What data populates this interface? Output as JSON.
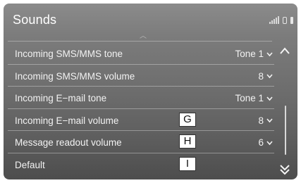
{
  "header": {
    "title": "Sounds"
  },
  "status_icons": [
    "signal-strength-icon",
    "phone-icon",
    "battery-icon"
  ],
  "settings": [
    {
      "label": "Incoming SMS/MMS tone",
      "value": "Tone 1",
      "callout": ""
    },
    {
      "label": "Incoming SMS/MMS volume",
      "value": "8",
      "callout": ""
    },
    {
      "label": "Incoming E−mail tone",
      "value": "Tone 1",
      "callout": ""
    },
    {
      "label": "Incoming E−mail volume",
      "value": "8",
      "callout": "G"
    },
    {
      "label": "Message readout volume",
      "value": "6",
      "callout": "H"
    },
    {
      "label": "Default",
      "value": "",
      "callout": "I"
    }
  ],
  "colors": {
    "screen_top": "#8b8b8b",
    "screen_bottom": "#4d4d4d",
    "text": "#f2f2f2",
    "callout_bg": "#ffffff"
  }
}
